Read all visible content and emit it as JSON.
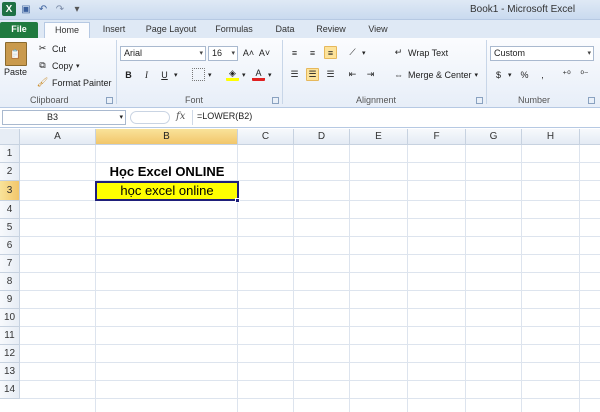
{
  "window": {
    "title": "Book1 - Microsoft Excel"
  },
  "tabs": [
    "File",
    "Home",
    "Insert",
    "Page Layout",
    "Formulas",
    "Data",
    "Review",
    "View"
  ],
  "clipboard": {
    "paste": "Paste",
    "cut": "Cut",
    "copy": "Copy",
    "format_painter": "Format Painter",
    "label": "Clipboard"
  },
  "font": {
    "name": "Arial",
    "size": "16",
    "bold": "B",
    "italic": "I",
    "underline": "U",
    "label": "Font"
  },
  "alignment": {
    "wrap_text": "Wrap Text",
    "merge_center": "Merge & Center",
    "label": "Alignment"
  },
  "number": {
    "format": "Custom",
    "percent": "%",
    "comma": ",",
    "label": "Number"
  },
  "formula_bar": {
    "name_box": "B3",
    "fx": "fx",
    "formula": "=LOWER(B2)"
  },
  "columns": [
    "A",
    "B",
    "C",
    "D",
    "E",
    "F",
    "G",
    "H"
  ],
  "rows": [
    "1",
    "2",
    "3",
    "4",
    "5",
    "6",
    "7",
    "8",
    "9",
    "10",
    "11",
    "12",
    "13",
    "14"
  ],
  "cells": {
    "B2": "Học Excel ONLINE",
    "B3": "học excel online"
  },
  "colors": {
    "selection_fill": "#ffff00",
    "file_tab": "#1f7a3f"
  }
}
